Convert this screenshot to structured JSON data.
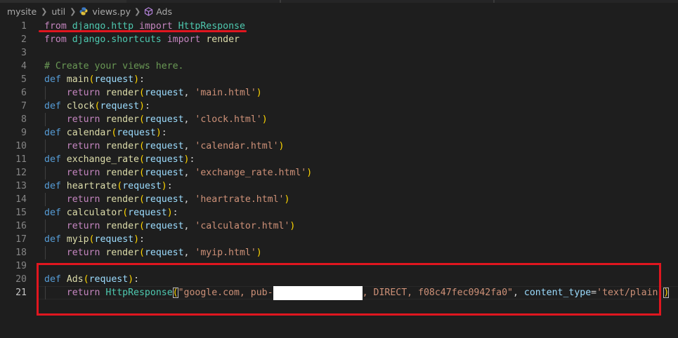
{
  "breadcrumb": {
    "items": [
      {
        "label": "mysite",
        "icon": null
      },
      {
        "label": "util",
        "icon": null
      },
      {
        "label": "views.py",
        "icon": "python-file-icon"
      },
      {
        "label": "Ads",
        "icon": "symbol-class-icon"
      }
    ],
    "separator_icon": "chevron-right-icon"
  },
  "editor": {
    "active_line": 21,
    "lines": [
      {
        "n": "1",
        "tokens": [
          {
            "t": "from",
            "c": "t-ctrl"
          },
          {
            "t": " ",
            "c": "t-plain"
          },
          {
            "t": "django.http",
            "c": "t-mod"
          },
          {
            "t": " ",
            "c": "t-plain"
          },
          {
            "t": "import",
            "c": "t-ctrl"
          },
          {
            "t": " ",
            "c": "t-plain"
          },
          {
            "t": "HttpResponse",
            "c": "t-mod"
          }
        ]
      },
      {
        "n": "2",
        "tokens": [
          {
            "t": "from",
            "c": "t-ctrl"
          },
          {
            "t": " ",
            "c": "t-plain"
          },
          {
            "t": "django.shortcuts",
            "c": "t-mod"
          },
          {
            "t": " ",
            "c": "t-plain"
          },
          {
            "t": "import",
            "c": "t-ctrl"
          },
          {
            "t": " ",
            "c": "t-plain"
          },
          {
            "t": "render",
            "c": "t-fn"
          }
        ]
      },
      {
        "n": "3",
        "tokens": []
      },
      {
        "n": "4",
        "tokens": [
          {
            "t": "# Create your views here.",
            "c": "t-cmt"
          }
        ]
      },
      {
        "n": "5",
        "tokens": [
          {
            "t": "def",
            "c": "t-kw"
          },
          {
            "t": " ",
            "c": "t-plain"
          },
          {
            "t": "main",
            "c": "t-fn"
          },
          {
            "t": "(",
            "c": "t-paren"
          },
          {
            "t": "request",
            "c": "t-param"
          },
          {
            "t": ")",
            "c": "t-paren"
          },
          {
            "t": ":",
            "c": "t-plain"
          }
        ]
      },
      {
        "n": "6",
        "indent": true,
        "tokens": [
          {
            "t": "    ",
            "c": "t-plain"
          },
          {
            "t": "return",
            "c": "t-ctrl"
          },
          {
            "t": " ",
            "c": "t-plain"
          },
          {
            "t": "render",
            "c": "t-fn"
          },
          {
            "t": "(",
            "c": "t-paren"
          },
          {
            "t": "request",
            "c": "t-param"
          },
          {
            "t": ", ",
            "c": "t-plain"
          },
          {
            "t": "'main.html'",
            "c": "t-str"
          },
          {
            "t": ")",
            "c": "t-paren"
          }
        ]
      },
      {
        "n": "7",
        "tokens": [
          {
            "t": "def",
            "c": "t-kw"
          },
          {
            "t": " ",
            "c": "t-plain"
          },
          {
            "t": "clock",
            "c": "t-fn"
          },
          {
            "t": "(",
            "c": "t-paren"
          },
          {
            "t": "request",
            "c": "t-param"
          },
          {
            "t": ")",
            "c": "t-paren"
          },
          {
            "t": ":",
            "c": "t-plain"
          }
        ]
      },
      {
        "n": "8",
        "indent": true,
        "tokens": [
          {
            "t": "    ",
            "c": "t-plain"
          },
          {
            "t": "return",
            "c": "t-ctrl"
          },
          {
            "t": " ",
            "c": "t-plain"
          },
          {
            "t": "render",
            "c": "t-fn"
          },
          {
            "t": "(",
            "c": "t-paren"
          },
          {
            "t": "request",
            "c": "t-param"
          },
          {
            "t": ", ",
            "c": "t-plain"
          },
          {
            "t": "'clock.html'",
            "c": "t-str"
          },
          {
            "t": ")",
            "c": "t-paren"
          }
        ]
      },
      {
        "n": "9",
        "tokens": [
          {
            "t": "def",
            "c": "t-kw"
          },
          {
            "t": " ",
            "c": "t-plain"
          },
          {
            "t": "calendar",
            "c": "t-fn"
          },
          {
            "t": "(",
            "c": "t-paren"
          },
          {
            "t": "request",
            "c": "t-param"
          },
          {
            "t": ")",
            "c": "t-paren"
          },
          {
            "t": ":",
            "c": "t-plain"
          }
        ]
      },
      {
        "n": "10",
        "indent": true,
        "tokens": [
          {
            "t": "    ",
            "c": "t-plain"
          },
          {
            "t": "return",
            "c": "t-ctrl"
          },
          {
            "t": " ",
            "c": "t-plain"
          },
          {
            "t": "render",
            "c": "t-fn"
          },
          {
            "t": "(",
            "c": "t-paren"
          },
          {
            "t": "request",
            "c": "t-param"
          },
          {
            "t": ", ",
            "c": "t-plain"
          },
          {
            "t": "'calendar.html'",
            "c": "t-str"
          },
          {
            "t": ")",
            "c": "t-paren"
          }
        ]
      },
      {
        "n": "11",
        "tokens": [
          {
            "t": "def",
            "c": "t-kw"
          },
          {
            "t": " ",
            "c": "t-plain"
          },
          {
            "t": "exchange_rate",
            "c": "t-fn"
          },
          {
            "t": "(",
            "c": "t-paren"
          },
          {
            "t": "request",
            "c": "t-param"
          },
          {
            "t": ")",
            "c": "t-paren"
          },
          {
            "t": ":",
            "c": "t-plain"
          }
        ]
      },
      {
        "n": "12",
        "indent": true,
        "tokens": [
          {
            "t": "    ",
            "c": "t-plain"
          },
          {
            "t": "return",
            "c": "t-ctrl"
          },
          {
            "t": " ",
            "c": "t-plain"
          },
          {
            "t": "render",
            "c": "t-fn"
          },
          {
            "t": "(",
            "c": "t-paren"
          },
          {
            "t": "request",
            "c": "t-param"
          },
          {
            "t": ", ",
            "c": "t-plain"
          },
          {
            "t": "'exchange_rate.html'",
            "c": "t-str"
          },
          {
            "t": ")",
            "c": "t-paren"
          }
        ]
      },
      {
        "n": "13",
        "tokens": [
          {
            "t": "def",
            "c": "t-kw"
          },
          {
            "t": " ",
            "c": "t-plain"
          },
          {
            "t": "heartrate",
            "c": "t-fn"
          },
          {
            "t": "(",
            "c": "t-paren"
          },
          {
            "t": "request",
            "c": "t-param"
          },
          {
            "t": ")",
            "c": "t-paren"
          },
          {
            "t": ":",
            "c": "t-plain"
          }
        ]
      },
      {
        "n": "14",
        "indent": true,
        "tokens": [
          {
            "t": "    ",
            "c": "t-plain"
          },
          {
            "t": "return",
            "c": "t-ctrl"
          },
          {
            "t": " ",
            "c": "t-plain"
          },
          {
            "t": "render",
            "c": "t-fn"
          },
          {
            "t": "(",
            "c": "t-paren"
          },
          {
            "t": "request",
            "c": "t-param"
          },
          {
            "t": ", ",
            "c": "t-plain"
          },
          {
            "t": "'heartrate.html'",
            "c": "t-str"
          },
          {
            "t": ")",
            "c": "t-paren"
          }
        ]
      },
      {
        "n": "15",
        "tokens": [
          {
            "t": "def",
            "c": "t-kw"
          },
          {
            "t": " ",
            "c": "t-plain"
          },
          {
            "t": "calculator",
            "c": "t-fn"
          },
          {
            "t": "(",
            "c": "t-paren"
          },
          {
            "t": "request",
            "c": "t-param"
          },
          {
            "t": ")",
            "c": "t-paren"
          },
          {
            "t": ":",
            "c": "t-plain"
          }
        ]
      },
      {
        "n": "16",
        "indent": true,
        "tokens": [
          {
            "t": "    ",
            "c": "t-plain"
          },
          {
            "t": "return",
            "c": "t-ctrl"
          },
          {
            "t": " ",
            "c": "t-plain"
          },
          {
            "t": "render",
            "c": "t-fn"
          },
          {
            "t": "(",
            "c": "t-paren"
          },
          {
            "t": "request",
            "c": "t-param"
          },
          {
            "t": ", ",
            "c": "t-plain"
          },
          {
            "t": "'calculator.html'",
            "c": "t-str"
          },
          {
            "t": ")",
            "c": "t-paren"
          }
        ]
      },
      {
        "n": "17",
        "tokens": [
          {
            "t": "def",
            "c": "t-kw"
          },
          {
            "t": " ",
            "c": "t-plain"
          },
          {
            "t": "myip",
            "c": "t-fn"
          },
          {
            "t": "(",
            "c": "t-paren"
          },
          {
            "t": "request",
            "c": "t-param"
          },
          {
            "t": ")",
            "c": "t-paren"
          },
          {
            "t": ":",
            "c": "t-plain"
          }
        ]
      },
      {
        "n": "18",
        "indent": true,
        "tokens": [
          {
            "t": "    ",
            "c": "t-plain"
          },
          {
            "t": "return",
            "c": "t-ctrl"
          },
          {
            "t": " ",
            "c": "t-plain"
          },
          {
            "t": "render",
            "c": "t-fn"
          },
          {
            "t": "(",
            "c": "t-paren"
          },
          {
            "t": "request",
            "c": "t-param"
          },
          {
            "t": ", ",
            "c": "t-plain"
          },
          {
            "t": "'myip.html'",
            "c": "t-str"
          },
          {
            "t": ")",
            "c": "t-paren"
          }
        ]
      },
      {
        "n": "19",
        "tokens": []
      },
      {
        "n": "20",
        "tokens": [
          {
            "t": "def",
            "c": "t-kw"
          },
          {
            "t": " ",
            "c": "t-plain"
          },
          {
            "t": "Ads",
            "c": "t-fn"
          },
          {
            "t": "(",
            "c": "t-paren"
          },
          {
            "t": "request",
            "c": "t-param"
          },
          {
            "t": ")",
            "c": "t-paren"
          },
          {
            "t": ":",
            "c": "t-plain"
          }
        ]
      },
      {
        "n": "21",
        "indent": true,
        "tokens": [
          {
            "t": "    ",
            "c": "t-plain"
          },
          {
            "t": "return",
            "c": "t-ctrl"
          },
          {
            "t": " ",
            "c": "t-plain"
          },
          {
            "t": "HttpResponse",
            "c": "t-mod"
          },
          {
            "t": "(",
            "c": "t-paren paren-box"
          },
          {
            "t": "\"google.com, pub-",
            "c": "t-str"
          },
          {
            "t": "                ",
            "c": "t-str redact-gap"
          },
          {
            "t": ", DIRECT, f08c47fec0942fa0\"",
            "c": "t-str"
          },
          {
            "t": ", ",
            "c": "t-plain"
          },
          {
            "t": "content_type",
            "c": "t-param"
          },
          {
            "t": "=",
            "c": "t-plain"
          },
          {
            "t": "'text/plain'",
            "c": "t-str"
          },
          {
            "t": ")",
            "c": "t-paren paren-box"
          }
        ]
      }
    ]
  },
  "annotations": {
    "color": "#e0161f"
  }
}
